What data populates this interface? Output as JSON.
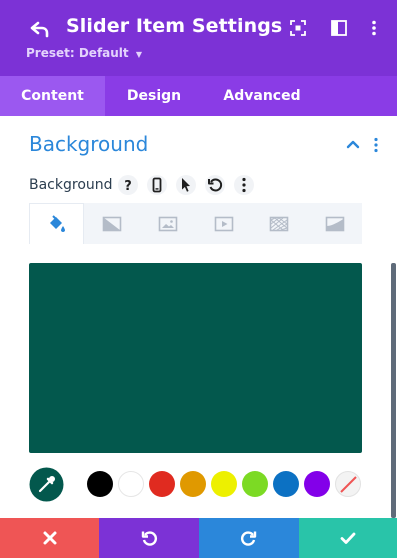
{
  "header": {
    "title": "Slider Item Settings",
    "preset": "Preset: Default",
    "icons": [
      "back-icon",
      "focus-icon",
      "columns-icon",
      "more-icon"
    ]
  },
  "tabs": [
    {
      "label": "Content",
      "active": true
    },
    {
      "label": "Design",
      "active": false
    },
    {
      "label": "Advanced",
      "active": false
    }
  ],
  "section": {
    "title": "Background",
    "collapsed": false
  },
  "option": {
    "label": "Background",
    "icons": [
      "help-icon",
      "mobile-icon",
      "cursor-icon",
      "reset-icon",
      "more-icon"
    ]
  },
  "background_tabs": [
    {
      "icon": "paint-bucket-icon",
      "active": true
    },
    {
      "icon": "gradient-icon",
      "active": false
    },
    {
      "icon": "image-icon",
      "active": false
    },
    {
      "icon": "video-icon",
      "active": false
    },
    {
      "icon": "pattern-icon",
      "active": false
    },
    {
      "icon": "mask-icon",
      "active": false
    }
  ],
  "color": {
    "selected": "#03584d"
  },
  "swatches": [
    {
      "name": "black",
      "color": "#000000"
    },
    {
      "name": "white",
      "color": "#ffffff"
    },
    {
      "name": "red",
      "color": "#e02b20"
    },
    {
      "name": "orange",
      "color": "#e09900"
    },
    {
      "name": "yellow",
      "color": "#edf000"
    },
    {
      "name": "green",
      "color": "#7cda24"
    },
    {
      "name": "blue",
      "color": "#0c71c3"
    },
    {
      "name": "purple",
      "color": "#8300e9"
    },
    {
      "name": "transparent",
      "color": "transparent"
    }
  ],
  "footer": {
    "buttons": [
      {
        "name": "cancel",
        "color": "#ef5555"
      },
      {
        "name": "undo",
        "color": "#7c32d6"
      },
      {
        "name": "redo",
        "color": "#2b87da"
      },
      {
        "name": "save",
        "color": "#29c4a9"
      }
    ]
  },
  "colors": {
    "header_bg": "#7c32d6",
    "tabs_bg": "#8a3ce6",
    "active_tab_bg": "#9b58f0",
    "accent": "#2b87da"
  }
}
